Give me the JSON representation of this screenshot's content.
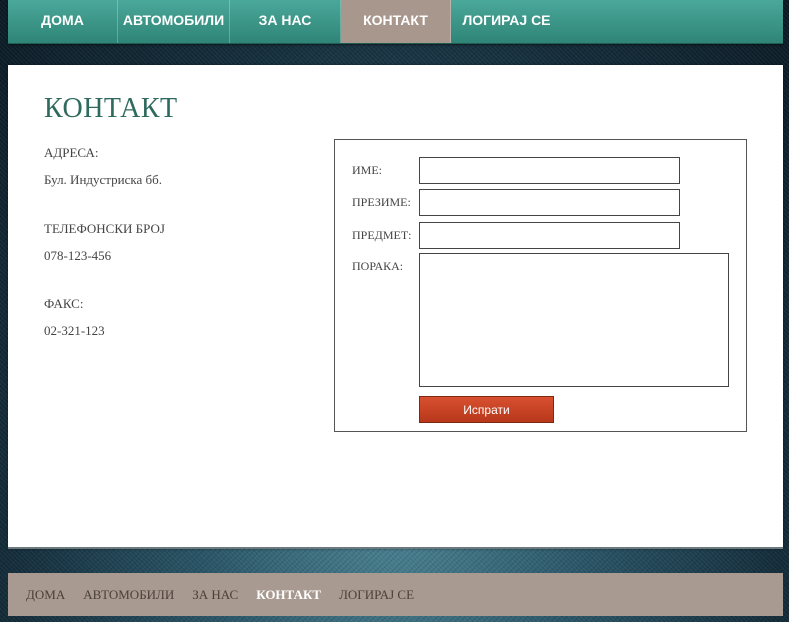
{
  "nav": {
    "items": [
      {
        "label": "ДОМА"
      },
      {
        "label": "АВТОМОБИЛИ"
      },
      {
        "label": "ЗА НАС"
      },
      {
        "label": "КОНТАКТ",
        "active": true
      },
      {
        "label": "ЛОГИРАЈ СЕ"
      }
    ]
  },
  "page": {
    "title": "КОНТАКТ"
  },
  "contact": {
    "address_label": "АДРЕСА:",
    "address_value": "Бул. Индустриска бб.",
    "phone_label": "ТЕЛЕФОНСКИ БРОЈ",
    "phone_value": "078-123-456",
    "fax_label": "ФАКС:",
    "fax_value": "02-321-123"
  },
  "form": {
    "name_label": "ИМЕ:",
    "name_value": "",
    "surname_label": "ПРЕЗИМЕ:",
    "surname_value": "",
    "subject_label": "ПРЕДМЕТ:",
    "subject_value": "",
    "message_label": "ПОРАКА:",
    "message_value": "",
    "submit_label": "Испрати"
  },
  "footer_nav": {
    "items": [
      {
        "label": "ДОМА"
      },
      {
        "label": "АВТОМОБИЛИ"
      },
      {
        "label": "ЗА НАС"
      },
      {
        "label": "КОНТАКТ",
        "active": true
      },
      {
        "label": "ЛОГИРАЈ СЕ"
      }
    ]
  },
  "colors": {
    "nav_teal": "#3a9587",
    "nav_active": "#a8978c",
    "title_green": "#2f6a5e",
    "button_red": "#c8401f",
    "footer_bg": "#a89a90"
  }
}
